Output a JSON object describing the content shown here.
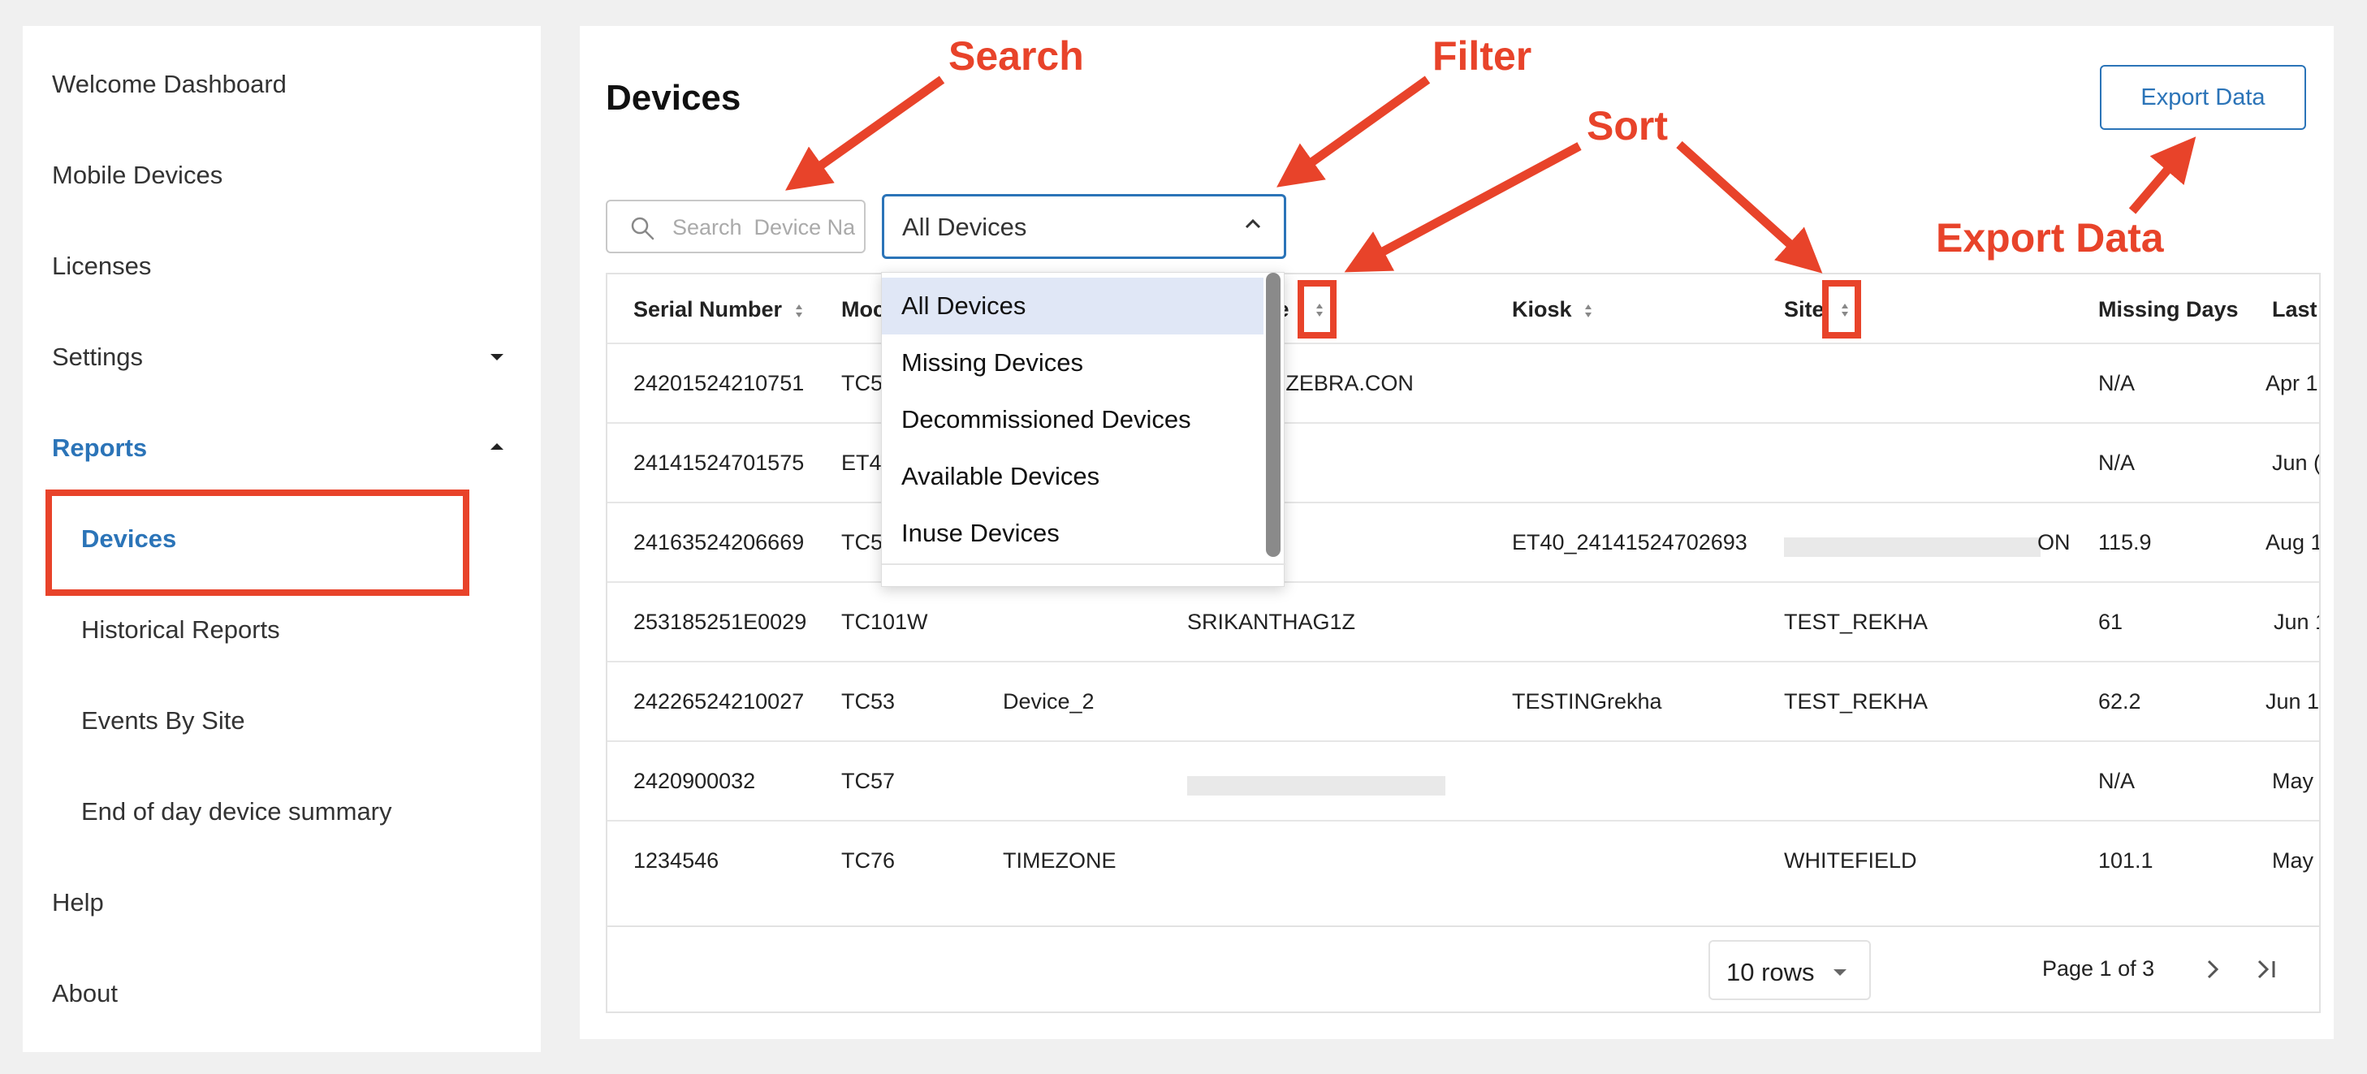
{
  "sidebar": {
    "items": [
      {
        "label": "Welcome Dashboard"
      },
      {
        "label": "Mobile Devices"
      },
      {
        "label": "Licenses"
      },
      {
        "label": "Settings"
      },
      {
        "label": "Reports"
      },
      {
        "label": "Devices"
      },
      {
        "label": "Historical Reports"
      },
      {
        "label": "Events By Site"
      },
      {
        "label": "End of day device summary"
      },
      {
        "label": "Help"
      },
      {
        "label": "About"
      }
    ]
  },
  "header": {
    "title": "Devices",
    "export_label": "Export Data"
  },
  "search": {
    "placeholder": "Search  Device Na"
  },
  "filter": {
    "selected": "All Devices",
    "options": [
      "All Devices",
      "Missing Devices",
      "Decommissioned Devices",
      "Available Devices",
      "Inuse Devices"
    ]
  },
  "table": {
    "headers": {
      "serial": "Serial Number",
      "model": "Moc",
      "name": "ne",
      "kiosk": "Kiosk",
      "site": "Site",
      "missing": "Missing Days",
      "last": "Last"
    },
    "rows": [
      {
        "serial": "24201524210751",
        "model": "TC5",
        "device": "",
        "user": "@ZEBRA.CON",
        "kiosk": "",
        "site": "",
        "missing": "N/A",
        "last": "Apr 1"
      },
      {
        "serial": "24141524701575",
        "model": "ET4",
        "device": "",
        "user": "",
        "kiosk": "",
        "site": "",
        "missing": "N/A",
        "last": "Jun ("
      },
      {
        "serial": "24163524206669",
        "model": "TC5",
        "device": "",
        "user": "",
        "kiosk": "ET40_24141524702693",
        "site": "ON",
        "missing": "115.9",
        "last": "Aug 1"
      },
      {
        "serial": "253185251E0029",
        "model": "TC101W",
        "device": "",
        "user": "SRIKANTHAG1Z",
        "kiosk": "",
        "site": "TEST_REKHA",
        "missing": "61",
        "last": "Jun 1"
      },
      {
        "serial": "24226524210027",
        "model": "TC53",
        "device": "Device_2",
        "user": "",
        "kiosk": "TESTINGrekha",
        "site": "TEST_REKHA",
        "missing": "62.2",
        "last": "Jun 1"
      },
      {
        "serial": "2420900032",
        "model": "TC57",
        "device": "",
        "user": "",
        "kiosk": "",
        "site": "",
        "missing": "N/A",
        "last": "May"
      },
      {
        "serial": "1234546",
        "model": "TC76",
        "device": "TIMEZONE",
        "user": "",
        "kiosk": "",
        "site": "WHITEFIELD",
        "missing": "101.1",
        "last": "May"
      }
    ]
  },
  "pagination": {
    "rows_label": "10 rows",
    "page_text": "Page 1 of 3"
  },
  "annotations": {
    "search": "Search",
    "filter": "Filter",
    "sort": "Sort",
    "export": "Export Data"
  },
  "colors": {
    "accent": "#2b74b8",
    "annotation": "#e8432a",
    "selected_option": "#e0e7f6"
  }
}
